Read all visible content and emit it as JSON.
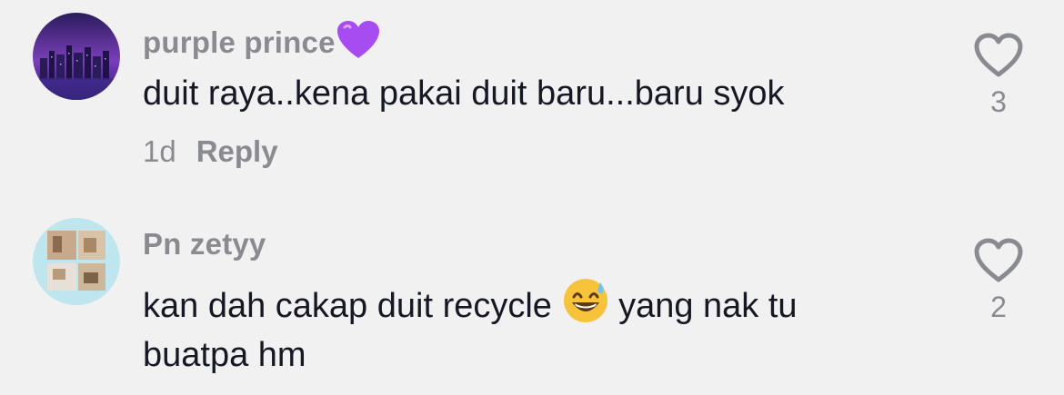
{
  "comments": [
    {
      "username": "purple prince",
      "username_emoji": "purple-heart-icon",
      "text": "duit raya..kena pakai duit baru...baru syok",
      "time": "1d",
      "reply_label": "Reply",
      "likes": "3"
    },
    {
      "username": "Pn zetyy",
      "text_line1_before": "kan dah cakap duit recycle",
      "text_emoji": "grinning-face-with-sweat-icon",
      "text_line1_after": "yang nak tu",
      "text_line2": "buatpa hm",
      "likes": "2"
    }
  ],
  "colors": {
    "background": "#f1f1f2",
    "primary_text": "#161823",
    "secondary_text": "#8a8b91",
    "heart_outline": "#8a8b91",
    "purple_heart": "#a64cf0"
  }
}
